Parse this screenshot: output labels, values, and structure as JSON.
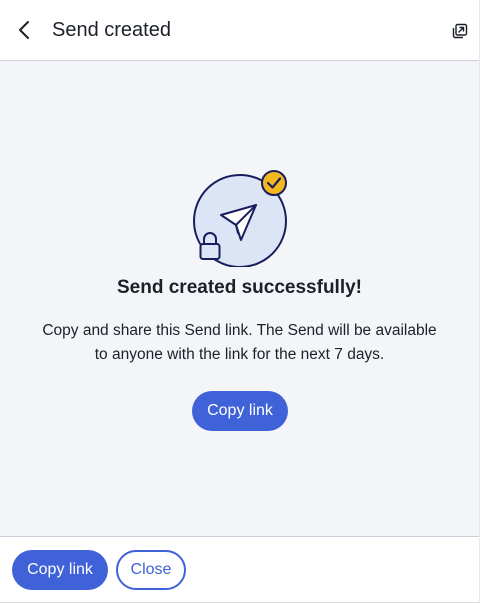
{
  "header": {
    "title": "Send created",
    "back_icon": "chevron-left-icon",
    "popout_icon": "popout-window-icon"
  },
  "main": {
    "success_title": "Send created successfully!",
    "description_line1": "Copy and share this Send link. The Send will be available",
    "description_line2": "to anyone with the link for the next 7 days.",
    "copy_link_label": "Copy link"
  },
  "footer": {
    "copy_link_label": "Copy link",
    "close_label": "Close"
  },
  "colors": {
    "primary": "#3f62d8",
    "illustration_fill": "#dbe5f6",
    "illustration_stroke": "#1a1d5c",
    "check_badge": "#f2b81e",
    "header_bg": "#ffffff",
    "main_bg": "#f4f5f8"
  }
}
